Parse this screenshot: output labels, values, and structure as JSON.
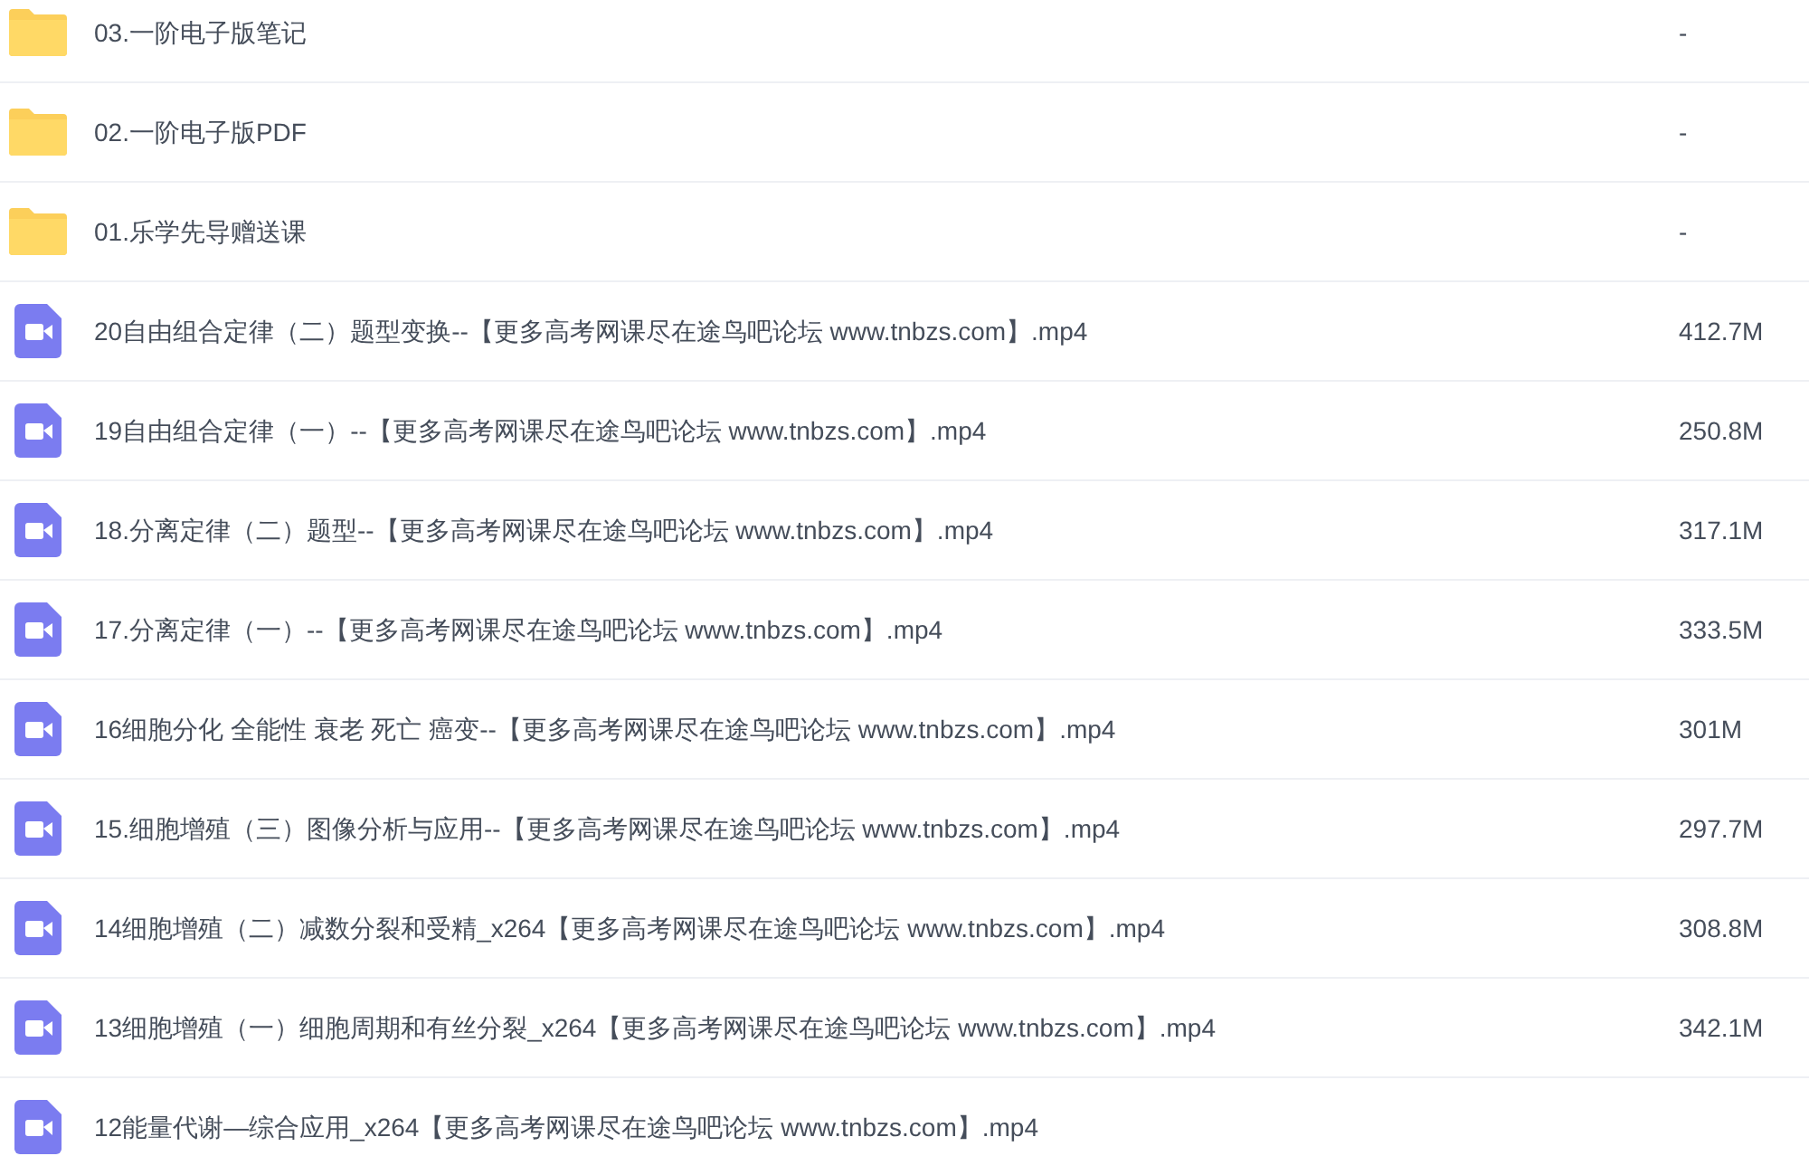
{
  "files": [
    {
      "kind": "folder",
      "name": "03.一阶电子版笔记",
      "size": "-"
    },
    {
      "kind": "folder",
      "name": "02.一阶电子版PDF",
      "size": "-"
    },
    {
      "kind": "folder",
      "name": "01.乐学先导赠送课",
      "size": "-"
    },
    {
      "kind": "video",
      "name": "20自由组合定律（二）题型变换--【更多高考网课尽在途鸟吧论坛 www.tnbzs.com】.mp4",
      "size": "412.7M"
    },
    {
      "kind": "video",
      "name": "19自由组合定律（一）--【更多高考网课尽在途鸟吧论坛 www.tnbzs.com】.mp4",
      "size": "250.8M"
    },
    {
      "kind": "video",
      "name": "18.分离定律（二）题型--【更多高考网课尽在途鸟吧论坛 www.tnbzs.com】.mp4",
      "size": "317.1M"
    },
    {
      "kind": "video",
      "name": "17.分离定律（一）--【更多高考网课尽在途鸟吧论坛 www.tnbzs.com】.mp4",
      "size": "333.5M"
    },
    {
      "kind": "video",
      "name": "16细胞分化 全能性 衰老 死亡 癌变--【更多高考网课尽在途鸟吧论坛 www.tnbzs.com】.mp4",
      "size": "301M"
    },
    {
      "kind": "video",
      "name": "15.细胞增殖（三）图像分析与应用--【更多高考网课尽在途鸟吧论坛 www.tnbzs.com】.mp4",
      "size": "297.7M"
    },
    {
      "kind": "video",
      "name": "14细胞增殖（二）减数分裂和受精_x264【更多高考网课尽在途鸟吧论坛 www.tnbzs.com】.mp4",
      "size": "308.8M"
    },
    {
      "kind": "video",
      "name": "13细胞增殖（一）细胞周期和有丝分裂_x264【更多高考网课尽在途鸟吧论坛 www.tnbzs.com】.mp4",
      "size": "342.1M"
    },
    {
      "kind": "video",
      "name": "12能量代谢—综合应用_x264【更多高考网课尽在途鸟吧论坛 www.tnbzs.com】.mp4"
    }
  ]
}
